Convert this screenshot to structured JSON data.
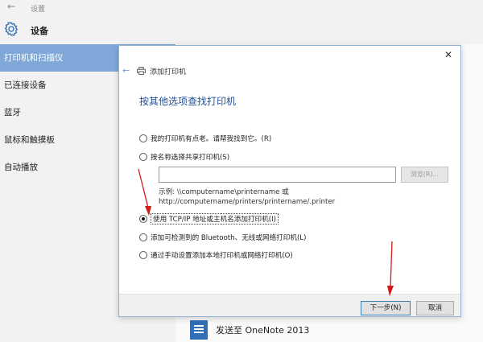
{
  "settings": {
    "topbar_back": "←",
    "topbar_title": "设置",
    "header_label": "设备",
    "nav": [
      {
        "label": "打印机和扫描仪",
        "active": true
      },
      {
        "label": "已连接设备",
        "active": false
      },
      {
        "label": "蓝牙",
        "active": false
      },
      {
        "label": "鼠标和触摸板",
        "active": false
      },
      {
        "label": "自动播放",
        "active": false
      }
    ],
    "onenote_label": "发送至 OneNote 2013"
  },
  "dialog": {
    "close": "✕",
    "back": "←",
    "title": "添加打印机",
    "heading": "按其他选项查找打印机",
    "options": [
      {
        "label": "我的打印机有点老。请帮我找到它。(R)",
        "checked": false
      },
      {
        "label": "按名称选择共享打印机(S)",
        "checked": false
      },
      {
        "label": "使用 TCP/IP 地址或主机名添加打印机(I)",
        "checked": true
      },
      {
        "label": "添加可检测到的 Bluetooth、无线或网络打印机(L)",
        "checked": false
      },
      {
        "label": "通过手动设置添加本地打印机或网络打印机(O)",
        "checked": false
      }
    ],
    "share_input_value": "",
    "browse_label": "浏览(R)...",
    "example_line1": "示例: \\\\computername\\printername 或",
    "example_line2": "http://computername/printers/printername/.printer",
    "next_label": "下一步(N)",
    "cancel_label": "取消"
  },
  "colors": {
    "accent": "#7fa8d8",
    "heading_blue": "#1f4e9b",
    "annotation_red": "#d11a1a"
  }
}
